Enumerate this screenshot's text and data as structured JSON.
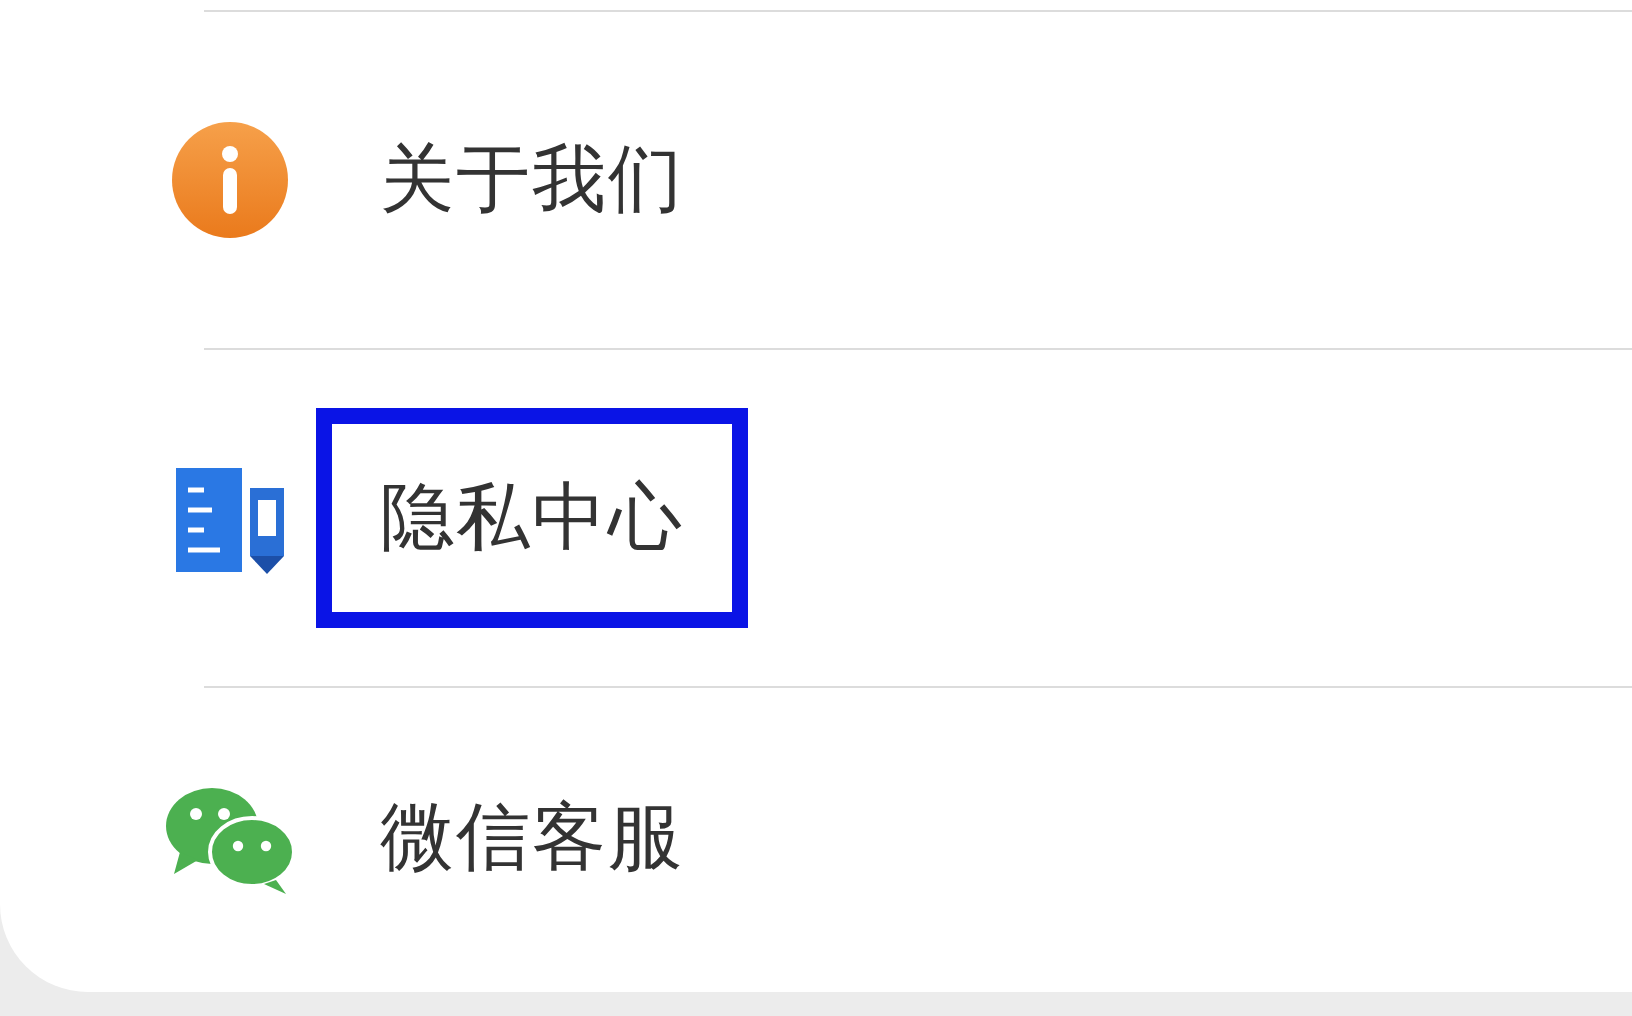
{
  "menu": {
    "items": [
      {
        "kind": "about",
        "label": "关于我们",
        "highlighted": false
      },
      {
        "kind": "privacy",
        "label": "隐私中心",
        "highlighted": true
      },
      {
        "kind": "wechat",
        "label": "微信客服",
        "highlighted": false
      }
    ]
  }
}
